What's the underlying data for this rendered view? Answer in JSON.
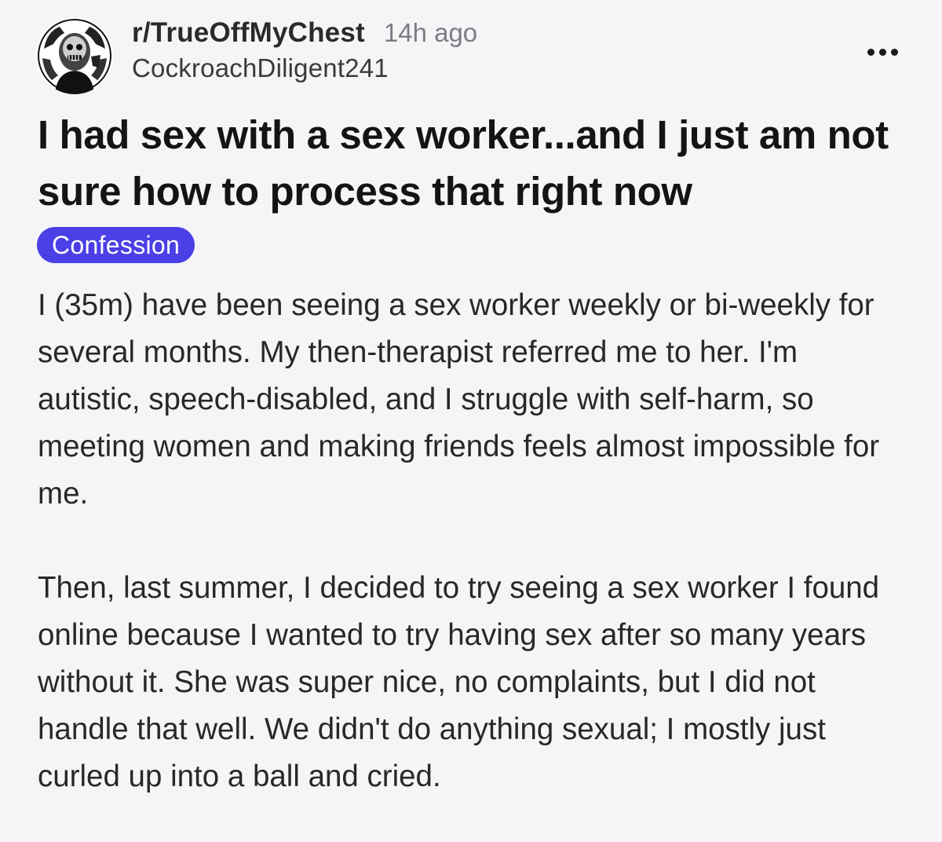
{
  "post": {
    "subreddit": "r/TrueOffMyChest",
    "time_ago": "14h ago",
    "author": "CockroachDiligent241",
    "title": "I had sex with a sex worker...and I just am not sure how to process that right now",
    "flair": "Confession",
    "paragraphs": [
      "I (35m) have been seeing a sex worker weekly or bi-weekly for several months. My then-therapist referred me to her. I'm autistic, speech-disabled, and I struggle with self-harm, so meeting women and making friends feels almost impossible for me.",
      "Then, last summer, I decided to try seeing a sex worker I found online because I wanted to try having sex after so many years without it. She was super nice, no complaints, but I did not handle that well. We didn't do anything sexual; I mostly just curled up into a ball and cried."
    ]
  },
  "icons": {
    "avatar": "subreddit-avatar-icon",
    "more": "more-options-icon"
  },
  "colors": {
    "background": "#f5f5f7",
    "flair_background": "#4b3fe6",
    "flair_text": "#ffffff",
    "meta_gray": "#7c7c83"
  }
}
